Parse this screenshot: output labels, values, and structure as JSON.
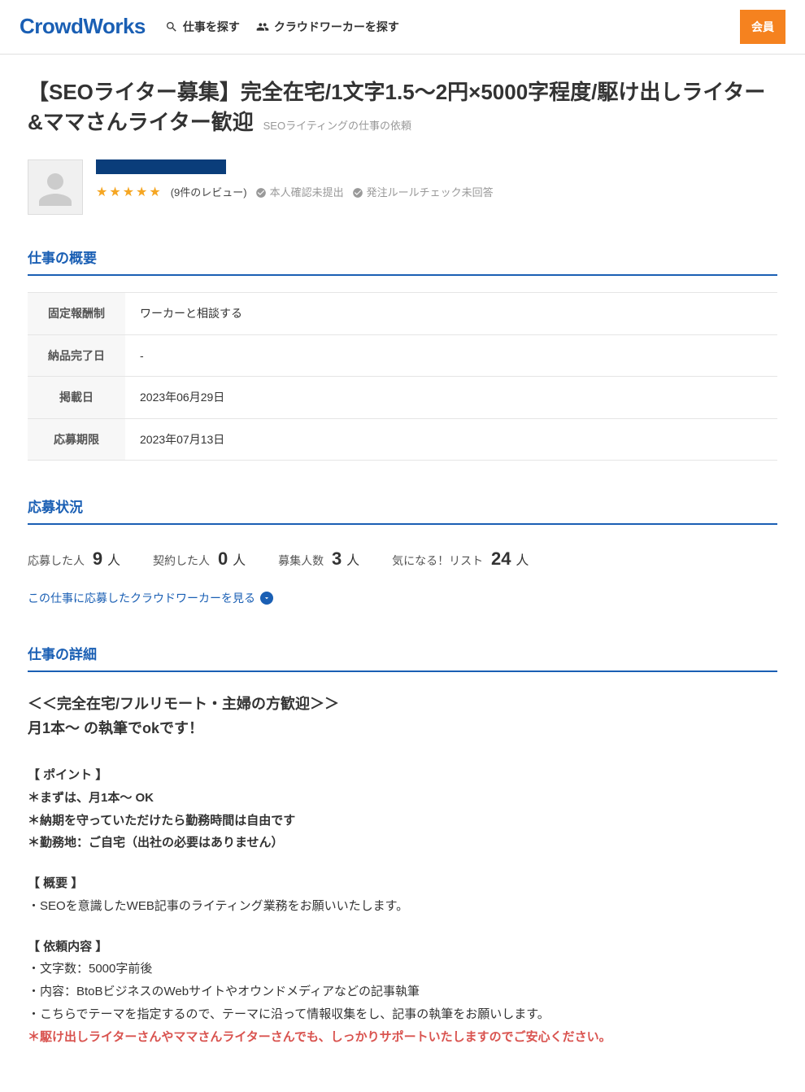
{
  "header": {
    "logo": "CrowdWorks",
    "nav": {
      "find_work": "仕事を探す",
      "find_worker": "クラウドワーカーを探す"
    },
    "signup": "会員"
  },
  "title": "【SEOライター募集】完全在宅/1文字1.5～2円×5000字程度/駆け出しライター&ママさんライター歓迎",
  "subtitle": "SEOライティングの仕事の依頼",
  "client": {
    "stars": "★★★★★",
    "review_count": "(9件のレビュー)",
    "identity_status": "本人確認未提出",
    "order_rule_status": "発注ルールチェック未回答"
  },
  "sections": {
    "summary_heading": "仕事の概要",
    "status_heading": "応募状況",
    "detail_heading": "仕事の詳細"
  },
  "summary": [
    {
      "label": "固定報酬制",
      "value": "ワーカーと相談する"
    },
    {
      "label": "納品完了日",
      "value": "-"
    },
    {
      "label": "掲載日",
      "value": "2023年06月29日"
    },
    {
      "label": "応募期限",
      "value": "2023年07月13日"
    }
  ],
  "status": {
    "applied_label": "応募した人",
    "applied_value": "9",
    "contracted_label": "契約した人",
    "contracted_value": "0",
    "hiring_label": "募集人数",
    "hiring_value": "3",
    "watch_label": "気になる！リスト",
    "watch_value": "24",
    "unit": "人"
  },
  "applicants_link": "この仕事に応募したクラウドワーカーを見る",
  "detail": {
    "lead1": "＜＜完全在宅/フルリモート・主婦の方歓迎＞＞",
    "lead2": "月1本～ の執筆でokです！",
    "points_heading": "【 ポイント 】",
    "point1": "＊まずは、月1本～ OK",
    "point2": "＊納期を守っていただけたら勤務時間は自由です",
    "point3": "＊勤務地：ご自宅（出社の必要はありません）",
    "overview_heading": "【 概要 】",
    "overview1": "・SEOを意識したWEB記事のライティング業務をお願いいたします。",
    "request_heading": "【 依頼内容 】",
    "request1": "・文字数：5000字前後",
    "request2": "・内容：BtoBビジネスのWebサイトやオウンドメディアなどの記事執筆",
    "request3": "・こちらでテーマを指定するので、テーマに沿って情報収集をし、記事の執筆をお願いします。",
    "request_red": "＊駆け出しライターさんやママさんライターさんでも、しっかりサポートいたしますのでご安心ください。"
  }
}
